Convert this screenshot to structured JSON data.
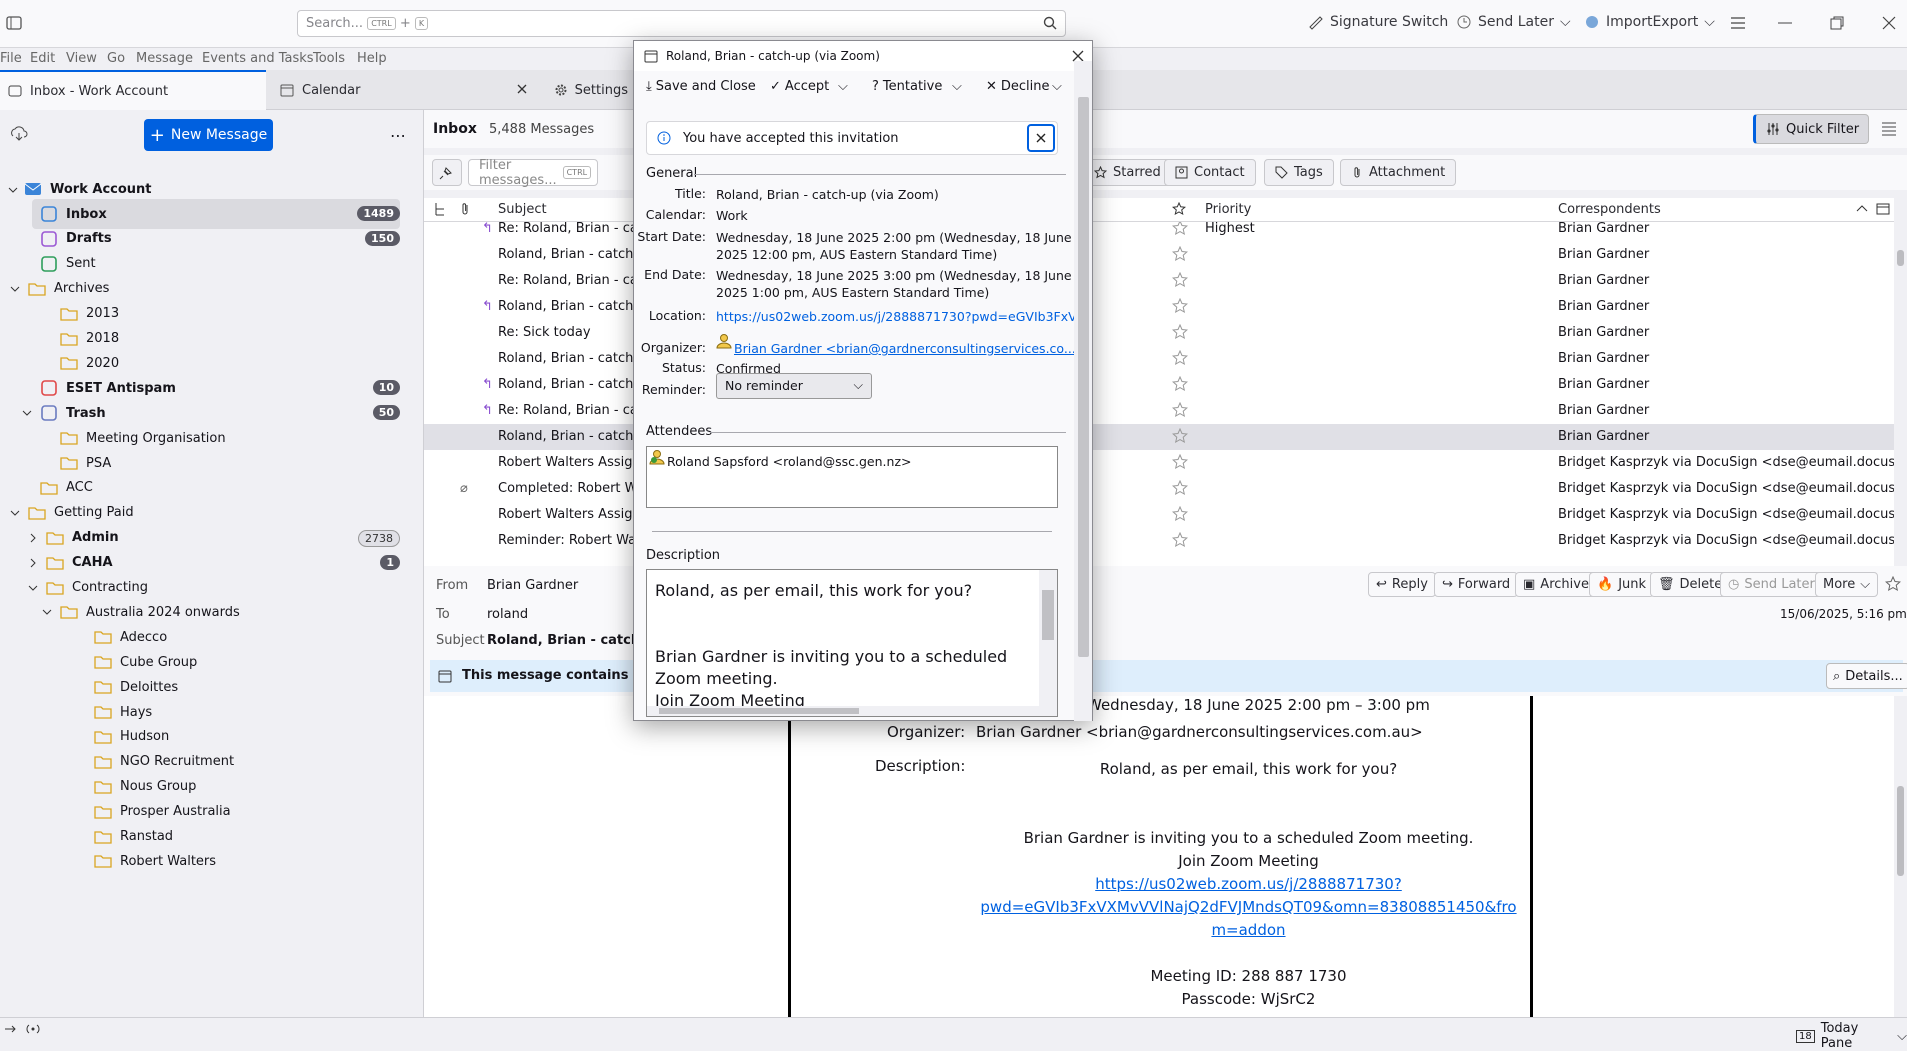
{
  "topbar": {
    "search_placeholder": "Search...",
    "kbd_ctrl": "CTRL",
    "kbd_plus": "+",
    "kbd_k": "K",
    "signature_switch": "Signature Switch",
    "send_later": "Send Later",
    "import_export": "ImportExport"
  },
  "menu": [
    "File",
    "Edit",
    "View",
    "Go",
    "Message",
    "Events and Tasks",
    "Tools",
    "Help"
  ],
  "tabs": {
    "inbox": "Inbox - Work Account",
    "calendar": "Calendar",
    "settings": "Settings"
  },
  "folders": {
    "new_message": "New Message",
    "account": "Work Account",
    "items": [
      {
        "label": "Inbox",
        "count": "1489",
        "bold": true
      },
      {
        "label": "Drafts",
        "count": "150",
        "bold": true
      },
      {
        "label": "Sent"
      },
      {
        "label": "Archives"
      },
      {
        "label": "2013"
      },
      {
        "label": "2018"
      },
      {
        "label": "2020"
      },
      {
        "label": "ESET Antispam",
        "count": "10",
        "bold": true
      },
      {
        "label": "Trash",
        "count": "50",
        "bold": true
      },
      {
        "label": "Meeting Organisation"
      },
      {
        "label": "PSA"
      },
      {
        "label": "ACC"
      },
      {
        "label": "Getting Paid"
      },
      {
        "label": "Admin",
        "count": "2738",
        "bold": true
      },
      {
        "label": "CAHA",
        "count": "1",
        "bold": true
      },
      {
        "label": "Contracting"
      },
      {
        "label": "Australia 2024 onwards"
      },
      {
        "label": "Adecco"
      },
      {
        "label": "Cube Group"
      },
      {
        "label": "Deloittes"
      },
      {
        "label": "Hays"
      },
      {
        "label": "Hudson"
      },
      {
        "label": "NGO Recruitment"
      },
      {
        "label": "Nous Group"
      },
      {
        "label": "Prosper Australia"
      },
      {
        "label": "Ranstad"
      },
      {
        "label": "Robert Walters"
      }
    ]
  },
  "list": {
    "title": "Inbox",
    "count": "5,488 Messages",
    "quick_filter": "Quick Filter",
    "filter_placeholder": "Filter messages...",
    "kbd": "CTRL",
    "starred": "Starred",
    "contact": "Contact",
    "tags": "Tags",
    "attachment": "Attachment",
    "col_subject": "Subject",
    "col_priority": "Priority",
    "col_correspondents": "Correspondents",
    "rows": [
      {
        "subject": "Re: Roland, Brian - catch-",
        "priority": "Highest",
        "from": "Brian Gardner"
      },
      {
        "subject": "Roland, Brian - catch-up",
        "priority": "",
        "from": "Brian Gardner"
      },
      {
        "subject": "Re: Roland, Brian - catc",
        "priority": "",
        "from": "Brian Gardner"
      },
      {
        "subject": "Roland, Brian - catch-up",
        "priority": "",
        "from": "Brian Gardner"
      },
      {
        "subject": "Re: Sick today",
        "priority": "",
        "from": "Brian Gardner"
      },
      {
        "subject": "Roland, Brian - catch-up",
        "priority": "",
        "from": "Brian Gardner"
      },
      {
        "subject": "Roland, Brian - catch-up",
        "priority": "",
        "from": "Brian Gardner"
      },
      {
        "subject": "Re: Roland, Brian - catc",
        "priority": "",
        "from": "Brian Gardner"
      },
      {
        "subject": "Roland, Brian - catch-up",
        "priority": "",
        "from": "Brian Gardner"
      },
      {
        "subject": "Robert Walters Assignm",
        "priority": "",
        "from": "Bridget Kasprzyk via DocuSign <dse@eumail.docusign..."
      },
      {
        "subject": "Completed: Robert Wal",
        "priority": "",
        "from": "Bridget Kasprzyk via DocuSign <dse@eumail.docusign..."
      },
      {
        "subject": "Robert Walters Assignm",
        "priority": "",
        "from": "Bridget Kasprzyk via DocuSign <dse@eumail.docusign..."
      },
      {
        "subject": "Reminder: Robert Walte",
        "priority": "",
        "from": "Bridget Kasprzyk via DocuSign <dse@eumail.docusign..."
      }
    ]
  },
  "preview": {
    "from_label": "From",
    "from": "Brian Gardner",
    "to_label": "To",
    "to": "roland",
    "subject_label": "Subject",
    "subject": "Roland, Brian - catch-up",
    "date": "15/06/2025, 5:16 pm",
    "reply": "Reply",
    "forward": "Forward",
    "archive": "Archive",
    "junk": "Junk",
    "delete": "Delete",
    "send_later": "Send Later",
    "more": "More",
    "banner": "This message contains an e",
    "details": "Details...",
    "when": "Wednesday, 18 June 2025 2:00 pm – 3:00 pm",
    "organizer_label": "Organizer:",
    "organizer": "Brian Gardner <brian@gardnerconsultingservices.com.au>",
    "description_label": "Description:",
    "desc1": "Roland, as per email, this work for you?",
    "desc2": "Brian Gardner is inviting you to a scheduled Zoom meeting.",
    "desc3": "Join Zoom Meeting",
    "link1": "https://us02web.zoom.us/j/2888871730?",
    "link2": "pwd=eGVIb3FxVXMvVVlNajQ2dFVJMndsQT09&omn=83808851450&fro",
    "link3": "m=addon",
    "meeting_id": "Meeting ID: 288 887 1730",
    "passcode": "Passcode: WjSrC2"
  },
  "dialog": {
    "title": "Roland, Brian - catch-up (via Zoom)",
    "save_close": "Save and Close",
    "accept": "Accept",
    "tentative": "Tentative",
    "decline": "Decline",
    "notice": "You have accepted this invitation",
    "general": "General",
    "title_label": "Title:",
    "title_value": "Roland, Brian - catch-up (via Zoom)",
    "calendar_label": "Calendar:",
    "calendar_value": "Work",
    "start_label": "Start Date:",
    "start_line1": "Wednesday, 18 June 2025 2:00 pm (Wednesday, 18 June",
    "start_line2": "2025 12:00 pm, AUS Eastern Standard Time)",
    "end_label": "End Date:",
    "end_line1": "Wednesday, 18 June 2025 3:00 pm (Wednesday, 18 June",
    "end_line2": "2025 1:00 pm, AUS Eastern Standard Time)",
    "location_label": "Location:",
    "location_value": "https://us02web.zoom.us/j/2888871730?pwd=eGVIb3FxV...",
    "organizer_label": "Organizer:",
    "organizer_value": "Brian Gardner <brian@gardnerconsultingservices.co...",
    "status_label": "Status:",
    "status_value": "Confirmed",
    "reminder_label": "Reminder:",
    "reminder_value": "No reminder",
    "attendees": "Attendees",
    "attendee": "Roland Sapsford <roland@ssc.gen.nz>",
    "description": "Description",
    "desc_line1": "Roland, as per email, this work for you?",
    "desc_line2": "Brian Gardner is inviting you to a scheduled",
    "desc_line3": "Zoom meeting.",
    "desc_line4": "Join Zoom Meeting"
  },
  "statusbar": {
    "today_pane": "Today Pane",
    "day": "18"
  }
}
